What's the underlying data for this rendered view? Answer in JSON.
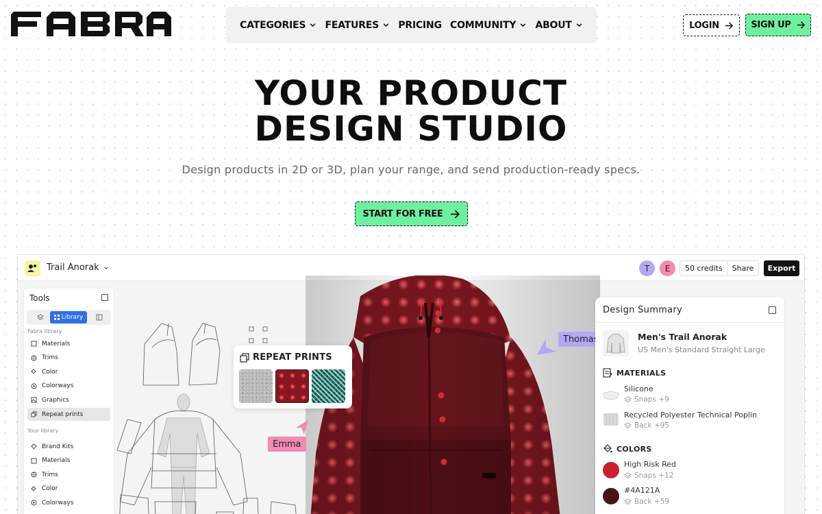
{
  "brand": {
    "name": "FABRA"
  },
  "nav": {
    "items": [
      {
        "label": "CATEGORIES",
        "dropdown": true
      },
      {
        "label": "FEATURES",
        "dropdown": true
      },
      {
        "label": "PRICING",
        "dropdown": false
      },
      {
        "label": "COMMUNITY",
        "dropdown": true
      },
      {
        "label": "ABOUT",
        "dropdown": true
      }
    ],
    "login_label": "LOGIN",
    "signup_label": "SIGN UP"
  },
  "hero": {
    "title_line1": "YOUR PRODUCT",
    "title_line2": "DESIGN STUDIO",
    "subtitle": "Design products in 2D or 3D, plan your range, and send production-ready specs.",
    "cta_label": "START FOR FREE"
  },
  "app": {
    "project_name": "Trail Anorak",
    "avatars": [
      "T",
      "E"
    ],
    "credits": "50 credits",
    "share_label": "Share",
    "export_label": "Export",
    "tools": {
      "title": "Tools",
      "active_tab": "Library",
      "fabra_group": "Fabra library",
      "fabra_items": [
        "Materials",
        "Trims",
        "Color",
        "Colorways",
        "Graphics",
        "Repeat prints"
      ],
      "active_item": "Repeat prints",
      "your_group": "Your library",
      "your_items": [
        "Brand Kits",
        "Materials",
        "Trims",
        "Color",
        "Colorways"
      ]
    },
    "repeat_prints": {
      "title": "REPEAT PRINTS"
    },
    "collaborators": {
      "emma": "Emma",
      "thomas": "Thomas"
    },
    "summary": {
      "title": "Design Summary",
      "product_name": "Men's Trail Anorak",
      "product_sub": "US Men's Standard Straight Large",
      "materials_heading": "MATERIALS",
      "materials": [
        {
          "name": "Silicone",
          "meta": "Snaps +9"
        },
        {
          "name": "Recycled Polyester Technical Poplin",
          "meta": "Back +95"
        }
      ],
      "colors_heading": "COLORS",
      "colors": [
        {
          "name": "High Risk Red",
          "meta": "Snaps +12",
          "hex": "#c8202f"
        },
        {
          "name": "#4A121A",
          "meta": "Back +59",
          "hex": "#4a121a"
        }
      ]
    }
  },
  "colors": {
    "accent_green": "#6ef0a0",
    "nav_bg": "#f1f1f1",
    "library_blue": "#2f6fe8",
    "emma_pink": "#f28ab3",
    "thomas_purple": "#b7a6f4"
  }
}
